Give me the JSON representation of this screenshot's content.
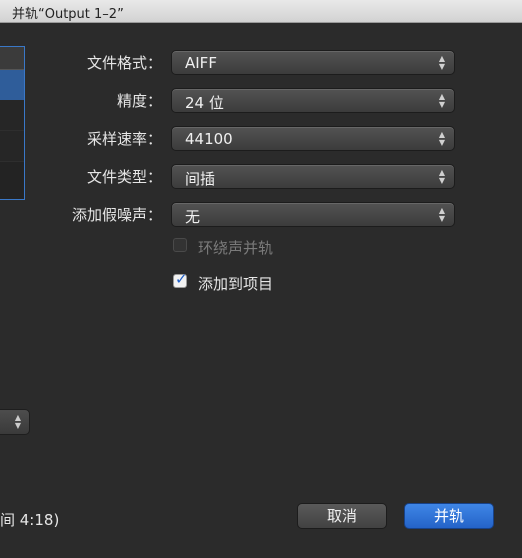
{
  "window": {
    "title": "并轨“Output 1–2”"
  },
  "form": {
    "file_format": {
      "label": "文件格式：",
      "value": "AIFF"
    },
    "bit_depth": {
      "label": "精度：",
      "value": "24 位"
    },
    "sample_rate": {
      "label": "采样速率：",
      "value": "44100"
    },
    "file_type": {
      "label": "文件类型：",
      "value": "间插"
    },
    "dither": {
      "label": "添加假噪声：",
      "value": "无"
    },
    "surround_bounce": {
      "label": "环绕声并轨",
      "checked": false,
      "enabled": false
    },
    "add_to_project": {
      "label": "添加到项目",
      "checked": true,
      "enabled": true
    }
  },
  "footer": {
    "duration_text": "间 4:18)",
    "cancel_label": "取消",
    "bounce_label": "并轨"
  },
  "colors": {
    "background": "#2b2b2b",
    "accent": "#2a6ed6",
    "selection": "#2f5d9a"
  }
}
